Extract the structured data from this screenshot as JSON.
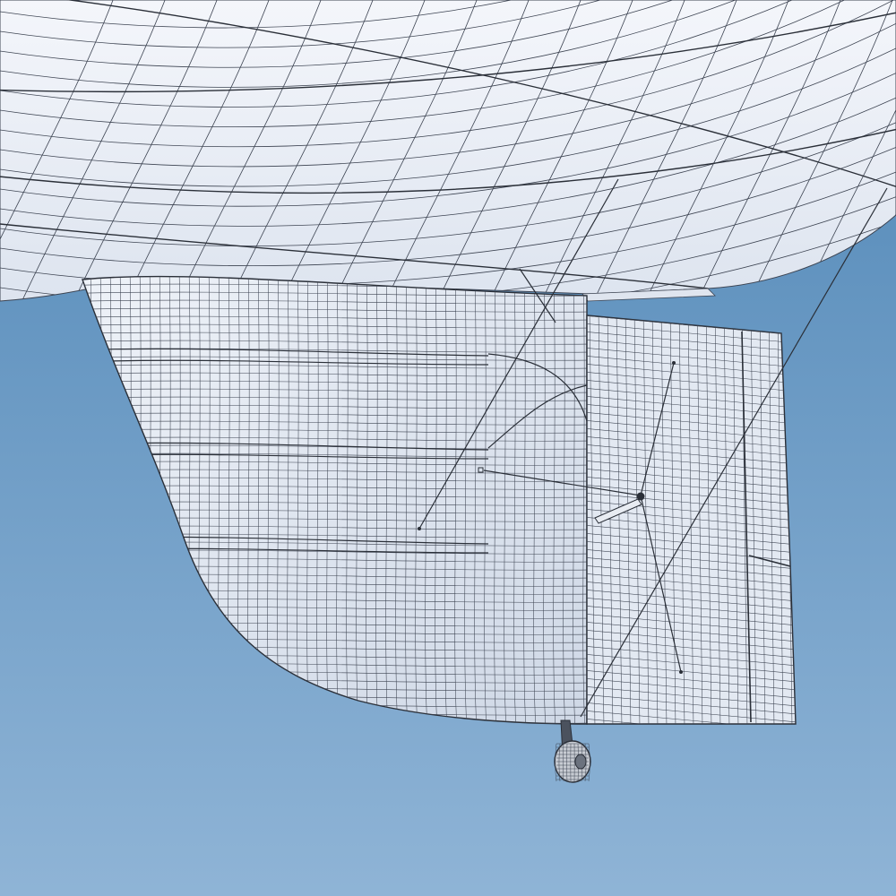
{
  "scene": {
    "subject": "airship-tail-fin-wireframe",
    "colors": {
      "sky_top": "#4f86b6",
      "sky_bottom": "#8fb4d6",
      "surface_light": "#f1f4fa",
      "surface_shade": "#c8d2e3",
      "wire": "#3d4452",
      "wire_dense": "#2a2f38",
      "wheel": "#c7cbd2"
    }
  }
}
